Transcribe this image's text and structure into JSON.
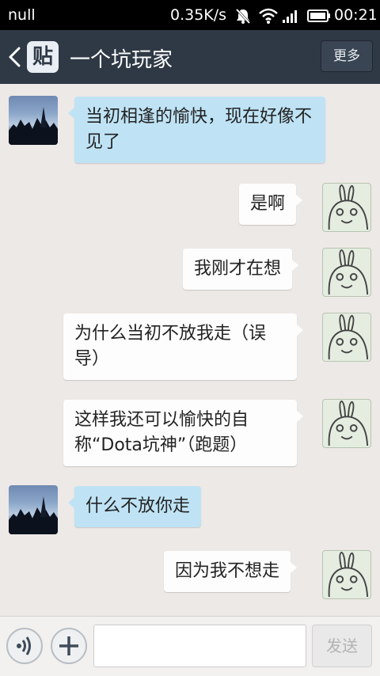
{
  "status_bar": {
    "carrier": "null",
    "network_speed": "0.35K/s",
    "time": "00:21",
    "icons": [
      "mute-icon",
      "wifi-icon",
      "signal-icon",
      "battery-icon"
    ]
  },
  "header": {
    "back_icon": "chevron-left-icon",
    "app_badge": "贴",
    "title": "一个坑玩家",
    "more_label": "更多"
  },
  "messages": [
    {
      "side": "in",
      "avatar": "sky-trees-avatar",
      "text": "当初相逢的愉快，现在好像不见了"
    },
    {
      "side": "out",
      "avatar": "bunny-avatar",
      "text": "是啊"
    },
    {
      "side": "out",
      "avatar": "bunny-avatar",
      "text": "我刚才在想"
    },
    {
      "side": "out",
      "avatar": "bunny-avatar",
      "text": "为什么当初不放我走（误导）"
    },
    {
      "side": "out",
      "avatar": "bunny-avatar",
      "text": "这样我还可以愉快的自称“Dota坑神”（跑题）"
    },
    {
      "side": "in",
      "avatar": "sky-trees-avatar",
      "text": "什么不放你走"
    },
    {
      "side": "out",
      "avatar": "bunny-avatar",
      "text": "因为我不想走"
    }
  ],
  "input_bar": {
    "voice_icon": "voice-icon",
    "plus_icon": "plus-icon",
    "message_value": "",
    "send_label": "发送"
  },
  "colors": {
    "status_bar_bg": "#000000",
    "header_bg": "#2f3946",
    "chat_bg": "#ede9e6",
    "incoming_bubble": "#bfe3f5",
    "outgoing_bubble": "#fdfdfd"
  }
}
